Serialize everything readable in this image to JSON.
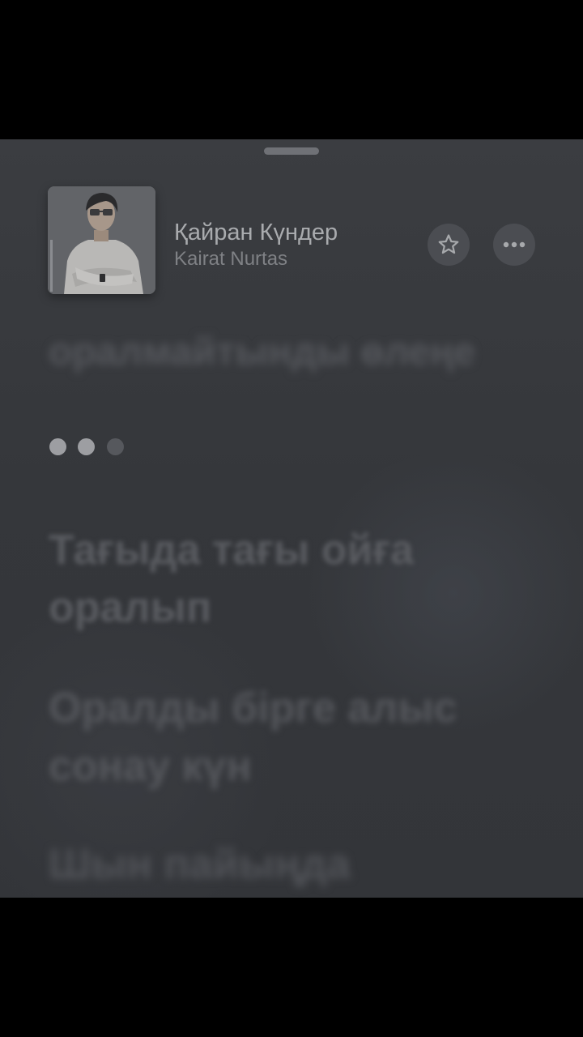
{
  "song": {
    "title": "Қайран Күндер",
    "artist": "Kairat Nurtas"
  },
  "actions": {
    "favorite_icon": "star-icon",
    "more_icon": "ellipsis-icon"
  },
  "lyrics": {
    "previous_line": "оралмайтынды өлеңе",
    "line1": [
      "Тағыда тағы ойға",
      "оралып"
    ],
    "line2": [
      "Оралды бірге алыс",
      "сонау күн"
    ],
    "line3": "Шын пайыңда"
  },
  "interlude_dots": {
    "count": 3,
    "lit": 2
  },
  "colors": {
    "background": "#38393d",
    "title": "#a9abae",
    "artist": "#7f8185",
    "dot_lit": "#9d9ea2"
  }
}
